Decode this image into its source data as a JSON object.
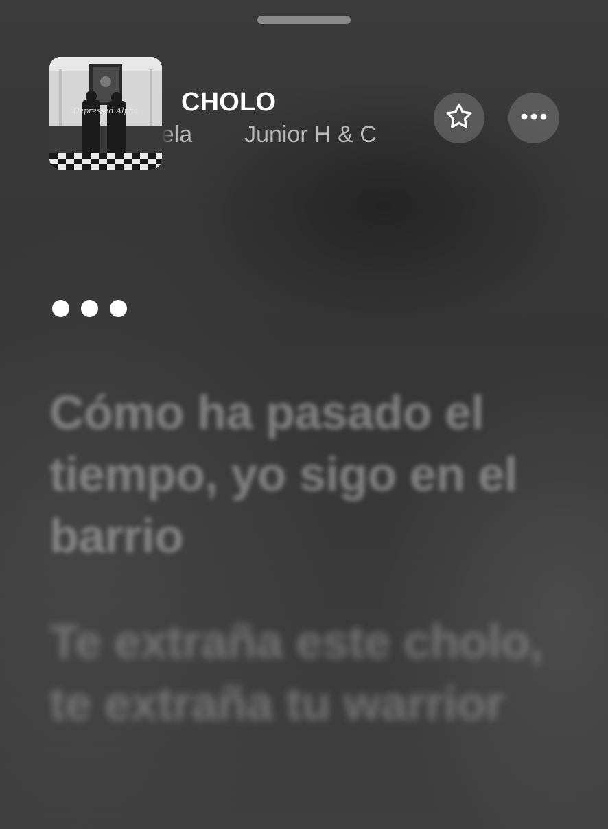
{
  "header": {
    "song_title": "CHOLO",
    "artist_fragment_left": "enzuela",
    "artist_fragment_right": "Junior H & C",
    "artwork_text": "Depressed Alpha"
  },
  "actions": [
    {
      "name": "favorite",
      "icon": "star-outline-icon"
    },
    {
      "name": "more",
      "icon": "ellipsis-icon"
    }
  ],
  "lyrics": {
    "instrumental_indicator": "•••",
    "lines": [
      "Cómo ha pasado el tiempo, yo sigo en el barrio",
      "Te extraña este cholo, te extraña tu warrior"
    ]
  },
  "colors": {
    "text_primary": "#ffffff",
    "text_secondary": "#b9b9b9",
    "button_bg": "#6f6f6f"
  }
}
